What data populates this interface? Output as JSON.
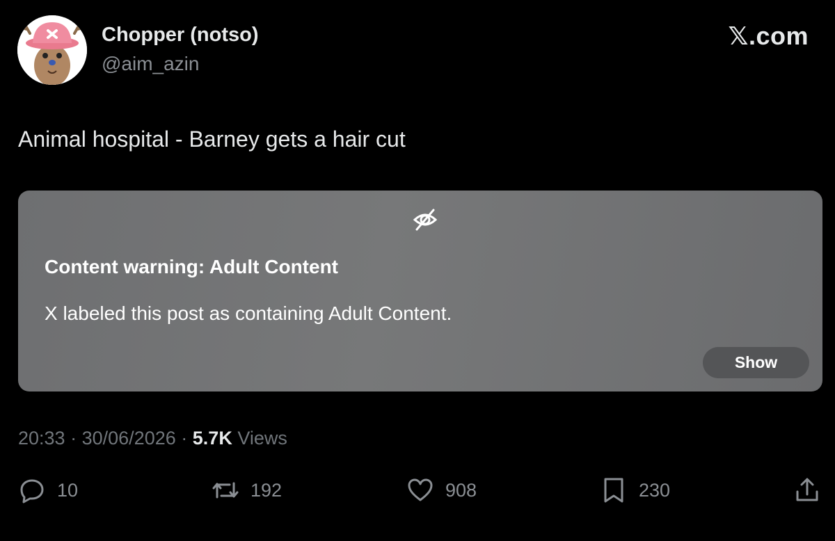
{
  "author": {
    "display_name": "Chopper (notso)",
    "handle": "@aim_azin",
    "avatar_icon": "chopper-avatar-icon"
  },
  "brand": {
    "logo_text": "𝕏.com"
  },
  "post": {
    "text": "Animal hospital - Barney gets a hair cut"
  },
  "content_warning": {
    "icon": "eye-off-icon",
    "title": "Content warning: Adult Content",
    "body": "X labeled this post as containing Adult Content.",
    "show_label": "Show"
  },
  "meta": {
    "time": "20:33",
    "date": "30/06/2026",
    "views_count": "5.7K",
    "views_label": "Views",
    "separator": "·"
  },
  "actions": {
    "replies": {
      "icon": "reply-icon",
      "count": "10"
    },
    "reposts": {
      "icon": "repost-icon",
      "count": "192"
    },
    "likes": {
      "icon": "heart-icon",
      "count": "908"
    },
    "bookmarks": {
      "icon": "bookmark-icon",
      "count": "230"
    },
    "share": {
      "icon": "share-icon"
    }
  },
  "colors": {
    "background": "#000000",
    "primary_text": "#e7e9ea",
    "secondary_text": "#71767b",
    "card_gray": "#727375",
    "button_gray": "#545557"
  }
}
